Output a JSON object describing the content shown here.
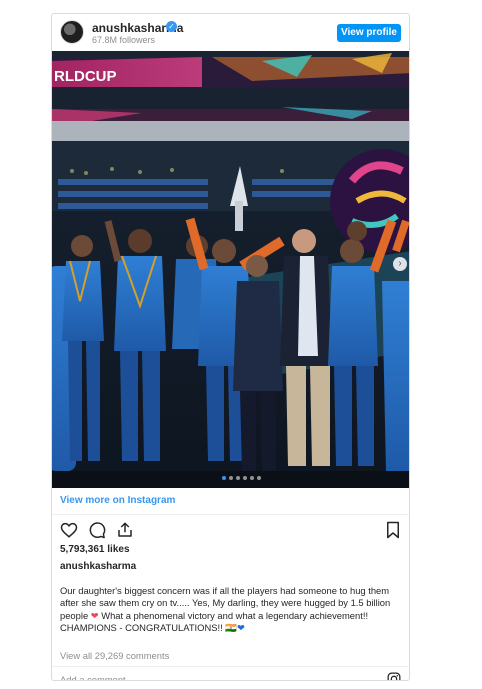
{
  "post": {
    "username": "anushkasharma",
    "followers": "67.8M followers",
    "view_profile_label": "View profile",
    "view_more_label": "View more on Instagram",
    "likes": "5,793,361 likes",
    "caption_user": "anushkasharma",
    "caption_text_1": "Our daughter's biggest concern was if all the players had someone to hug them after she saw them cry on tv..... Yes, My darling, they were hugged by 1.5 billion people ",
    "caption_text_2": " What a phenomenal victory and what a legendary achievement!! CHAMPIONS - CONGRATULATIONS!! ",
    "caption_flag": "🇮🇳",
    "view_comments": "View all 29,269 comments",
    "comment_placeholder": "Add a comment..."
  },
  "photo": {
    "banner_text": "RLDCUP",
    "dots_count": 6,
    "active_dot": 0
  },
  "colors": {
    "accent": "#0095f6",
    "link": "#3897f0",
    "muted": "#8e8e8e",
    "heart": "#ed4956"
  }
}
